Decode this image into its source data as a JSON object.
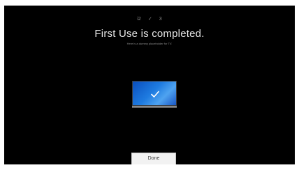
{
  "wizard": {
    "steps": [
      "i2",
      "✓",
      "3"
    ],
    "title": "First Use is completed.",
    "subtitle": "Here is a dummy placeholder for TV."
  },
  "illustration": {
    "icon": "check-icon",
    "colors": {
      "screen": "#1e7be0",
      "check": "#ffffff"
    }
  },
  "footer": {
    "done_label": "Done"
  }
}
